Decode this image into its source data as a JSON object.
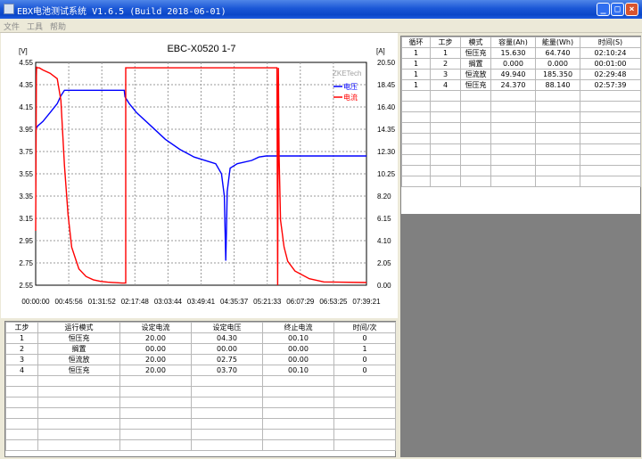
{
  "window": {
    "title": "EBX电池测试系统 V1.6.5 (Build 2018-06-01)"
  },
  "menu": {
    "items": [
      "文件",
      "工具",
      "帮助"
    ]
  },
  "chart_data": {
    "type": "line",
    "title": "EBC-X0520  1-7",
    "left_unit": "[V]",
    "right_unit": "[A]",
    "watermark": "ZKETech",
    "x_ticks": [
      "00:00:00",
      "00:45:56",
      "01:31:52",
      "02:17:48",
      "03:03:44",
      "03:49:41",
      "04:35:37",
      "05:21:33",
      "06:07:29",
      "06:53:25",
      "07:39:21"
    ],
    "y_left_ticks": [
      "4.55",
      "4.35",
      "4.15",
      "3.95",
      "3.75",
      "3.55",
      "3.35",
      "3.15",
      "2.95",
      "2.75",
      "2.55"
    ],
    "y_right_ticks": [
      "20.50",
      "18.45",
      "16.40",
      "14.35",
      "12.30",
      "10.25",
      "8.20",
      "6.15",
      "4.10",
      "2.05",
      "0.00"
    ],
    "ylim_left": [
      2.55,
      4.55
    ],
    "ylim_right": [
      0,
      20.5
    ],
    "xlim_minutes": [
      0,
      459.35
    ],
    "grid": true,
    "legend_position": "top-right",
    "series": [
      {
        "name": "电压",
        "axis": "left",
        "color": "#0000ff",
        "x": [
          0,
          3,
          10,
          20,
          30,
          35,
          40,
          60,
          90,
          120,
          123,
          124,
          126,
          130,
          140,
          160,
          180,
          200,
          220,
          240,
          250,
          258,
          262,
          263,
          264,
          265,
          266,
          268,
          270,
          280,
          300,
          310,
          320,
          330,
          459.35
        ],
        "y": [
          3.95,
          3.98,
          4.02,
          4.1,
          4.18,
          4.25,
          4.3,
          4.3,
          4.3,
          4.3,
          4.3,
          4.24,
          4.22,
          4.18,
          4.1,
          3.98,
          3.86,
          3.77,
          3.7,
          3.66,
          3.64,
          3.55,
          3.35,
          3.05,
          2.77,
          3.05,
          3.39,
          3.5,
          3.6,
          3.64,
          3.67,
          3.7,
          3.71,
          3.71,
          3.71
        ]
      },
      {
        "name": "电流",
        "axis": "right",
        "color": "#ff0000",
        "x": [
          0,
          1,
          1.3,
          2,
          5,
          10,
          20,
          30,
          35,
          40,
          45,
          50,
          55,
          60,
          70,
          80,
          90,
          100,
          120,
          125,
          125.1,
          126,
          160,
          200,
          240,
          270,
          305,
          330,
          335,
          336,
          337,
          338,
          340,
          345,
          350,
          360,
          380,
          400,
          459.35
        ],
        "y": [
          5.0,
          19.2,
          20.1,
          20.0,
          20.0,
          19.8,
          19.5,
          19.0,
          17.0,
          11.0,
          6.5,
          3.5,
          2.5,
          1.5,
          0.8,
          0.5,
          0.35,
          0.28,
          0.2,
          0.2,
          20.0,
          20.0,
          20.0,
          20.0,
          20.0,
          20.0,
          20.0,
          20.0,
          20.0,
          0.0,
          20.0,
          12.0,
          6.0,
          3.5,
          2.2,
          1.3,
          0.6,
          0.3,
          0.25
        ]
      }
    ]
  },
  "summary_table": {
    "headers": [
      "循环",
      "工步",
      "模式",
      "容量(Ah)",
      "能量(Wh)",
      "时间(S)"
    ],
    "rows": [
      [
        "1",
        "1",
        "恒压充",
        "15.630",
        "64.740",
        "02:10:24"
      ],
      [
        "1",
        "2",
        "搁置",
        "0.000",
        "0.000",
        "00:01:00"
      ],
      [
        "1",
        "3",
        "恒流放",
        "49.940",
        "185.350",
        "02:29:48"
      ],
      [
        "1",
        "4",
        "恒压充",
        "24.370",
        "88.140",
        "02:57:39"
      ]
    ]
  },
  "steps_table": {
    "headers": [
      "工步",
      "运行模式",
      "设定电流",
      "设定电压",
      "终止电流",
      "时间/次"
    ],
    "rows": [
      [
        "1",
        "恒压充",
        "20.00",
        "04.30",
        "00.10",
        "0"
      ],
      [
        "2",
        "搁置",
        "00.00",
        "00.00",
        "00.00",
        "1"
      ],
      [
        "3",
        "恒流放",
        "20.00",
        "02.75",
        "00.00",
        "0"
      ],
      [
        "4",
        "恒压充",
        "20.00",
        "03.70",
        "00.10",
        "0"
      ]
    ]
  }
}
